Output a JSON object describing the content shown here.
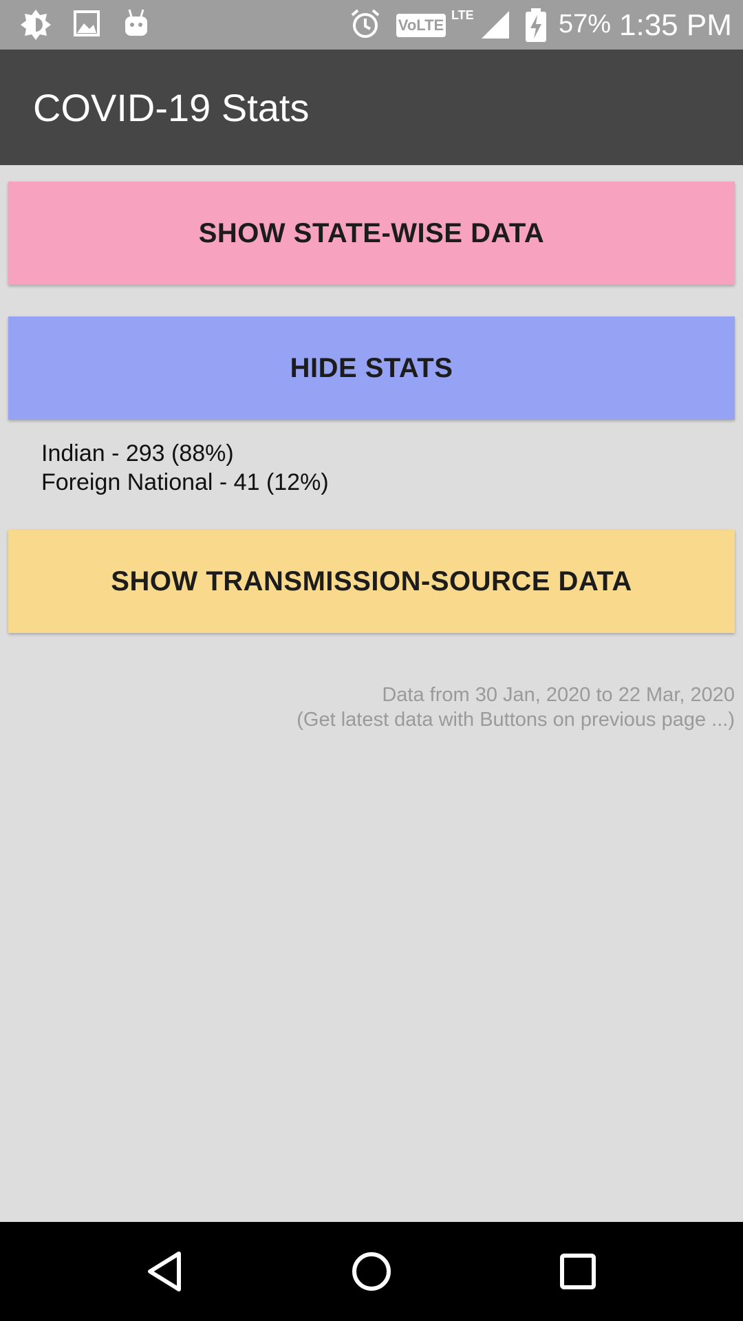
{
  "status_bar": {
    "battery_percent": "57%",
    "time": "1:35 PM",
    "network_type": "LTE",
    "volte_label": "VoLTE",
    "icons": [
      "brightness-icon",
      "gallery-icon",
      "android-debug-icon",
      "alarm-icon",
      "volte-icon",
      "signal-icon",
      "battery-charging-icon"
    ]
  },
  "app_bar": {
    "title": "COVID-19 Stats"
  },
  "buttons": {
    "state_wise": "SHOW STATE-WISE DATA",
    "hide_stats": "HIDE STATS",
    "transmission_source": "SHOW TRANSMISSION-SOURCE DATA"
  },
  "stats": {
    "indian": "Indian - 293 (88%)",
    "foreign": "Foreign National - 41 (12%)"
  },
  "note": {
    "line1": "Data from 30 Jan, 2020 to 22 Mar, 2020",
    "line2": "(Get latest data with Buttons on previous page ...)"
  },
  "colors": {
    "status_bar": "#9e9e9e",
    "app_bar": "#464646",
    "state_button": "#f7a3c0",
    "hide_button": "#96a3f4",
    "transmission_button": "#f9da8d",
    "background": "#dddddd"
  },
  "nav_bar": {
    "icons": [
      "back-icon",
      "home-icon",
      "recents-icon"
    ]
  }
}
